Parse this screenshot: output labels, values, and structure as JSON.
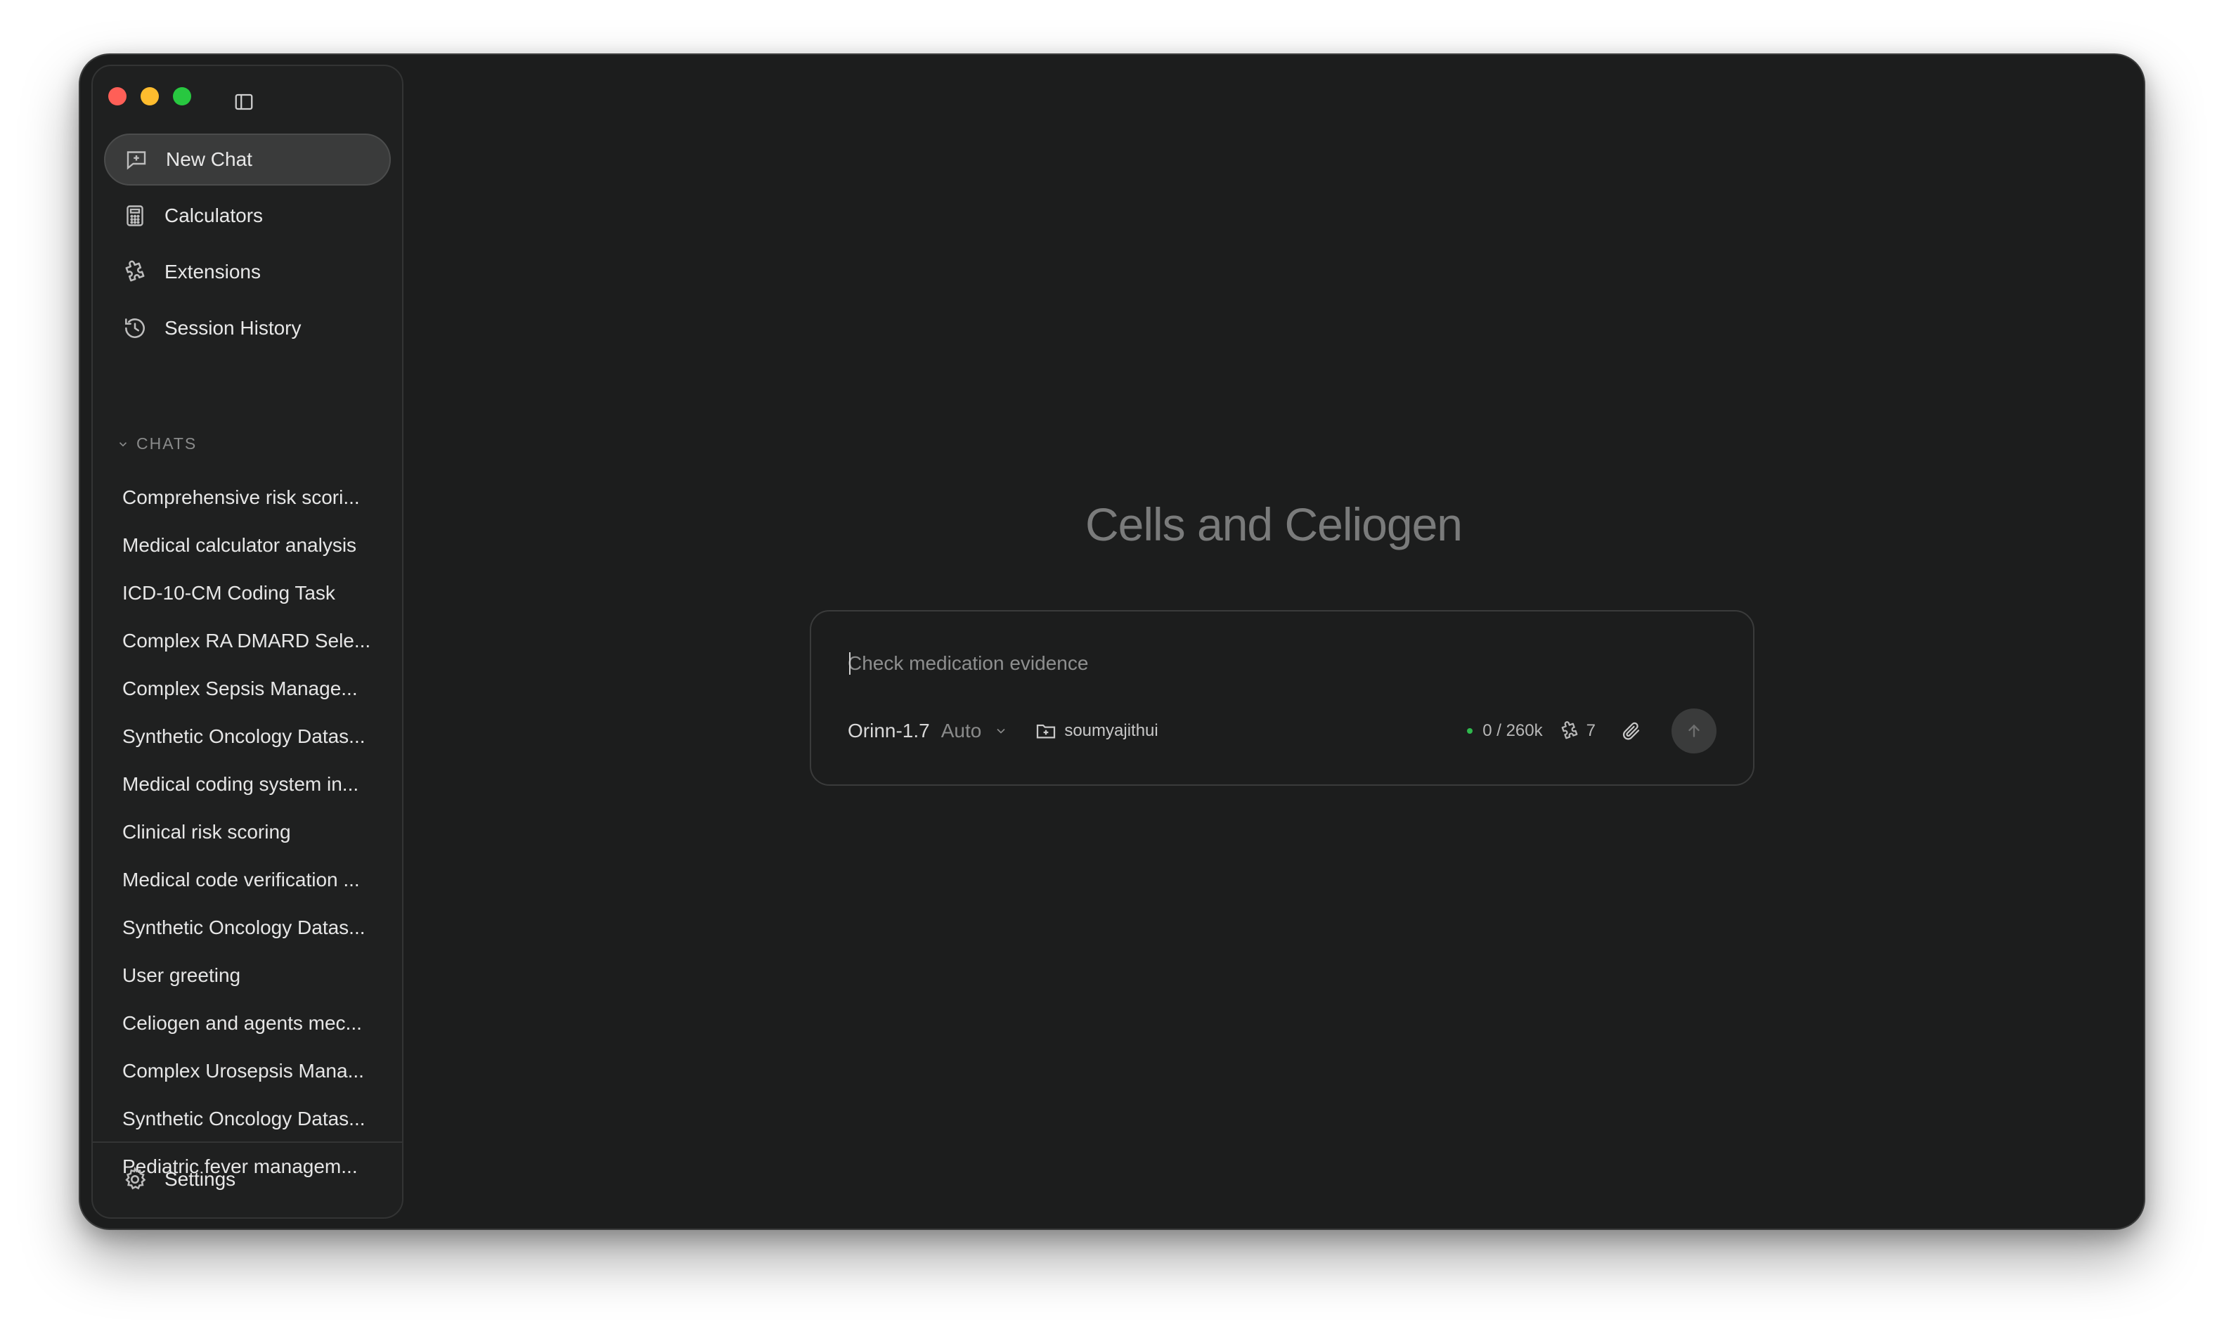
{
  "window": {
    "traffic_lights": {
      "close_color": "#ff5f57",
      "minimize_color": "#febc2e",
      "maximize_color": "#28c840"
    }
  },
  "sidebar": {
    "nav": [
      {
        "label": "New Chat",
        "icon": "new-chat-icon"
      },
      {
        "label": "Calculators",
        "icon": "calculator-icon"
      },
      {
        "label": "Extensions",
        "icon": "puzzle-icon"
      },
      {
        "label": "Session History",
        "icon": "history-icon"
      }
    ],
    "chats_label": "CHATS",
    "chats": [
      "Comprehensive risk scori...",
      "Medical calculator analysis",
      "ICD-10-CM Coding Task",
      "Complex RA DMARD Sele...",
      "Complex Sepsis Manage...",
      "Synthetic Oncology Datas...",
      "Medical coding system in...",
      "Clinical risk scoring",
      "Medical code verification ...",
      "Synthetic Oncology Datas...",
      "User greeting",
      "Celiogen and agents mec...",
      "Complex Urosepsis Mana...",
      "Synthetic Oncology Datas...",
      "Pediatric fever managem..."
    ],
    "settings_label": "Settings"
  },
  "main": {
    "title": "Cells and Celiogen",
    "composer": {
      "placeholder": "Check medication evidence",
      "value": "",
      "model_name": "Orinn-1.7",
      "model_mode": "Auto",
      "folder": "soumyajithui",
      "context_usage": "0 / 260k",
      "extensions_count": "7",
      "status_color": "#2fb84d"
    }
  }
}
